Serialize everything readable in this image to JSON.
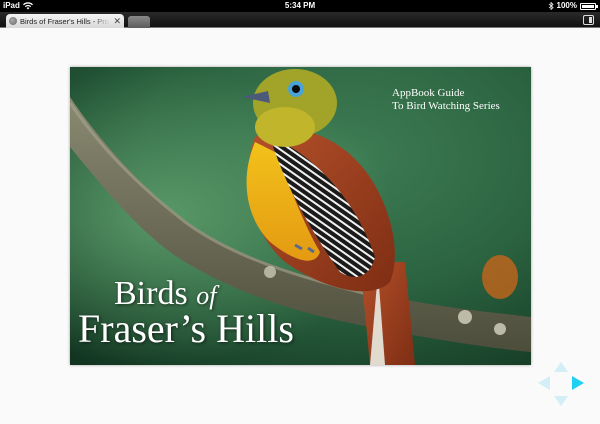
{
  "status_bar": {
    "carrier": "iPad",
    "time": "5:34 PM",
    "battery": "100%"
  },
  "browser": {
    "tab_title": "Birds of Fraser's Hills - Pro",
    "close_glyph": "✕"
  },
  "cover": {
    "series_line_1": "AppBook Guide",
    "series_line_2": "To Bird Watching Series",
    "title_word_1": "Birds ",
    "title_word_2": "of",
    "title_line_2": "Fraser’s Hills"
  },
  "icons": {
    "wifi": "wifi-icon",
    "bluetooth": "bluetooth-icon",
    "battery": "battery-icon",
    "favicon": "globe-icon",
    "nav_up": "arrow-up-icon",
    "nav_down": "arrow-down-icon",
    "nav_left": "arrow-left-icon",
    "nav_right": "arrow-right-icon"
  },
  "colors": {
    "status_bar": "#000000",
    "nav_active": "#1fd0f0",
    "nav_inactive": "#d3eef6"
  }
}
